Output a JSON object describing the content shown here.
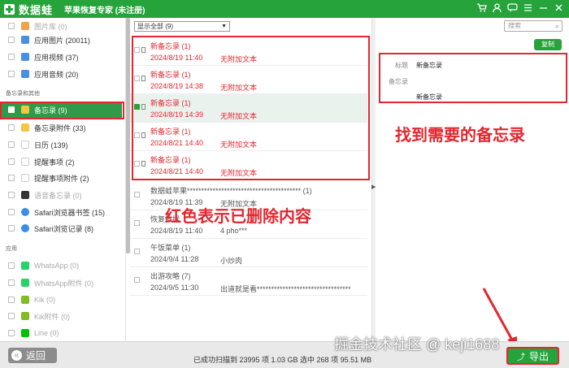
{
  "titlebar": {
    "brand": "数据蛙",
    "title": "苹果恢复专家 (未注册)",
    "icons": [
      "cart-icon",
      "user-icon",
      "chat-icon",
      "menu-icon",
      "minimize-icon",
      "close-icon"
    ]
  },
  "sidebar": {
    "items_top": [
      {
        "label": "图片库 (0)",
        "dim": true
      },
      {
        "label": "应用图片 (20011)",
        "dim": false
      },
      {
        "label": "应用视频 (37)",
        "dim": false
      },
      {
        "label": "应用音频 (20)",
        "dim": false
      }
    ],
    "section_memo": "备忘录和其他",
    "items_memo": [
      {
        "label": "备忘录 (9)",
        "active": true,
        "icon_color": "#f4c542"
      },
      {
        "label": "备忘录附件 (33)",
        "active": false,
        "icon_color": "#f4c542"
      },
      {
        "label": "日历 (139)",
        "active": false,
        "icon_color": "#e8e8e8"
      },
      {
        "label": "提醒事项 (2)",
        "active": false,
        "icon_color": "#ffffff"
      },
      {
        "label": "提醒事项附件 (2)",
        "active": false,
        "icon_color": "#ffffff"
      },
      {
        "label": "语音备忘录 (0)",
        "active": false,
        "dim": true,
        "icon_color": "#333333"
      },
      {
        "label": "Safari浏览器书签 (15)",
        "active": false,
        "icon_color": "#3a8ee6"
      },
      {
        "label": "Safari浏览记录 (8)",
        "active": false,
        "icon_color": "#3a8ee6"
      }
    ],
    "section_apps": "应用",
    "items_apps": [
      {
        "label": "WhatsApp (0)",
        "icon_color": "#25d366"
      },
      {
        "label": "WhatsApp附件 (0)",
        "icon_color": "#25d366"
      },
      {
        "label": "Kik (0)",
        "icon_color": "#82bc23"
      },
      {
        "label": "Kik附件 (0)",
        "icon_color": "#82bc23"
      },
      {
        "label": "Line (0)",
        "icon_color": "#00c300"
      }
    ]
  },
  "list": {
    "filter": "显示全部 (9)",
    "rows": [
      {
        "title": "新备忘录 (1)",
        "date": "2024/8/19 11:40",
        "extra": "无附加文本",
        "style": "red",
        "checked": false
      },
      {
        "title": "新备忘录 (1)",
        "date": "2024/8/19 14:38",
        "extra": "无附加文本",
        "style": "red",
        "checked": false
      },
      {
        "title": "新备忘录 (1)",
        "date": "2024/8/19 14:39",
        "extra": "无附加文本",
        "style": "red",
        "checked": true
      },
      {
        "title": "新备忘录 (1)",
        "date": "2024/8/21 14:40",
        "extra": "无附加文本",
        "style": "red",
        "checked": false
      },
      {
        "title": "新备忘录 (1)",
        "date": "2024/8/21 14:40",
        "extra": "无附加文本",
        "style": "red",
        "checked": false
      },
      {
        "title": "数据蛙苹果**************************************** (1)",
        "date": "2024/8/19 11:39",
        "extra": "无附加文本",
        "style": "gray",
        "checked": false
      },
      {
        "title": "恢复数据",
        "date": "2024/8/19 11:40",
        "extra": "4 pho***",
        "style": "gray",
        "checked": false
      },
      {
        "title": "午饭菜单 (1)",
        "date": "2024/9/4 11:28",
        "extra": "小炒肉",
        "style": "gray",
        "checked": false
      },
      {
        "title": "出游攻略 (7)",
        "date": "2024/9/5 11:30",
        "extra": "出道就是看*********************************",
        "style": "gray",
        "checked": false
      }
    ]
  },
  "detail": {
    "search_placeholder": "搜索",
    "copy_label": "复制",
    "title_label": "标题",
    "title_value": "新备忘录",
    "memo_label": "备忘录",
    "memo_value": "新备忘录"
  },
  "annotations": {
    "find_memo": "找到需要的备忘录",
    "red_deleted": "红色表示已删除内容",
    "watermark": "掘金技术社区 @ keji1688"
  },
  "bottom": {
    "back_label": "返回",
    "status": "已成功扫描到 23995 项 1.03 GB  选中 268 项 95.51 MB",
    "export_label": "导出"
  },
  "colors": {
    "brand_green": "#27a33b",
    "deleted_red": "#e3262f"
  }
}
